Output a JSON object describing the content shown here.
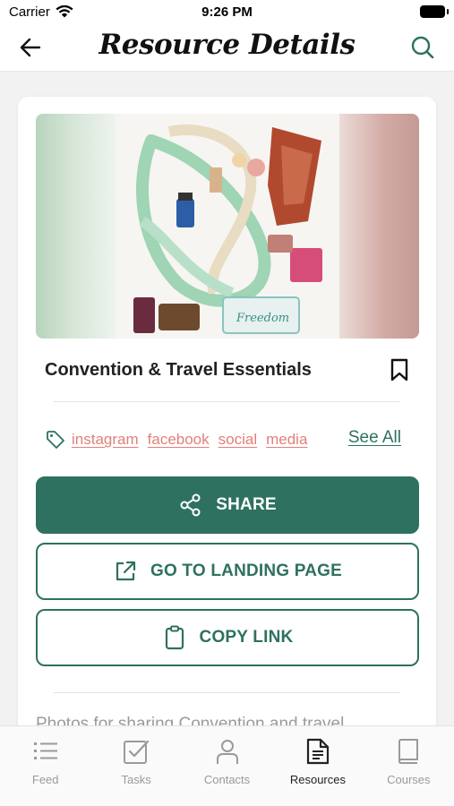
{
  "status_bar": {
    "carrier": "Carrier",
    "time": "9:26 PM"
  },
  "nav": {
    "title": "Resource Details",
    "back_icon": "arrow-left-icon",
    "search_icon": "search-icon"
  },
  "resource": {
    "title": "Convention & Travel Essentials",
    "image_alt": "resource-photo",
    "tags": [
      "instagram",
      "facebook",
      "social",
      "media"
    ],
    "see_all_label": "See All",
    "description": "Photos for sharing Convention and travel"
  },
  "actions": {
    "share_label": "SHARE",
    "landing_label": "GO TO LANDING PAGE",
    "copy_label": "COPY LINK"
  },
  "tab_bar": {
    "items": [
      {
        "label": "Feed",
        "icon": "list-icon"
      },
      {
        "label": "Tasks",
        "icon": "checkbox-icon"
      },
      {
        "label": "Contacts",
        "icon": "person-icon"
      },
      {
        "label": "Resources",
        "icon": "document-icon"
      },
      {
        "label": "Courses",
        "icon": "book-icon"
      }
    ],
    "active_index": 3
  },
  "colors": {
    "accent": "#2e7160",
    "tag": "#e0807a",
    "inactive_tab": "#9a9a9a"
  }
}
